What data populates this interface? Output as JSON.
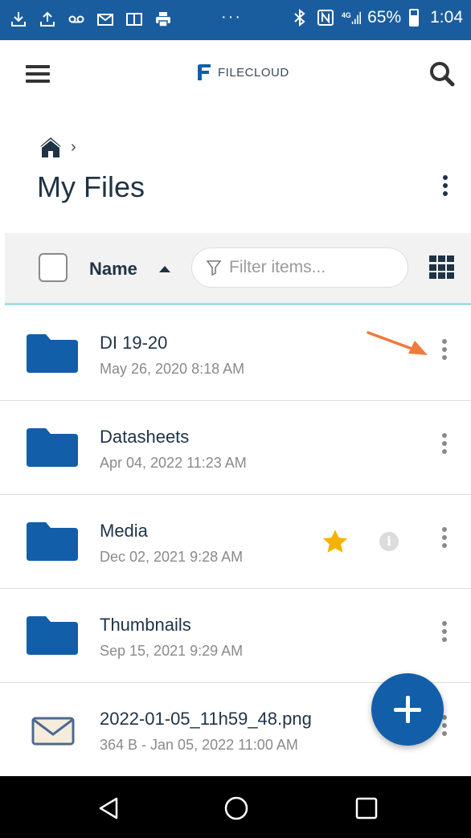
{
  "status_bar": {
    "battery": "65%",
    "time": "1:04",
    "network": "4G",
    "icons": [
      "download-icon",
      "upload-icon",
      "voicemail-icon",
      "gmail-icon",
      "reader-icon",
      "print-icon",
      "more-dots-icon",
      "bluetooth-icon",
      "nfc-icon",
      "signal-icon",
      "battery-icon"
    ]
  },
  "app_bar": {
    "logo_text": "FILECLOUD",
    "icons": [
      "hamburger-menu-icon",
      "search-icon"
    ]
  },
  "breadcrumb": {
    "separator": "›"
  },
  "page": {
    "title": "My Files"
  },
  "toolbar": {
    "sort_label": "Name",
    "filter_placeholder": "Filter items..."
  },
  "files": [
    {
      "name": "DI 19-20",
      "meta": "May 26, 2020 8:18 AM",
      "type": "folder"
    },
    {
      "name": "Datasheets",
      "meta": "Apr 04, 2022 11:23 AM",
      "type": "folder"
    },
    {
      "name": "Media",
      "meta": "Dec 02, 2021 9:28 AM",
      "type": "folder",
      "starred": true,
      "info": "i"
    },
    {
      "name": "Thumbnails",
      "meta": "Sep 15, 2021 9:29 AM",
      "type": "folder"
    },
    {
      "name": "2022-01-05_11h59_48.png",
      "meta": "364 B - Jan 05, 2022 11:00 AM",
      "type": "image"
    }
  ],
  "colors": {
    "status_bar": "#1a5d9e",
    "folder": "#135ea8",
    "fab": "#135ea8",
    "star": "#f5b301",
    "annotation_arrow": "#f07a3c",
    "toolbar_bg": "#f2f2f2"
  }
}
